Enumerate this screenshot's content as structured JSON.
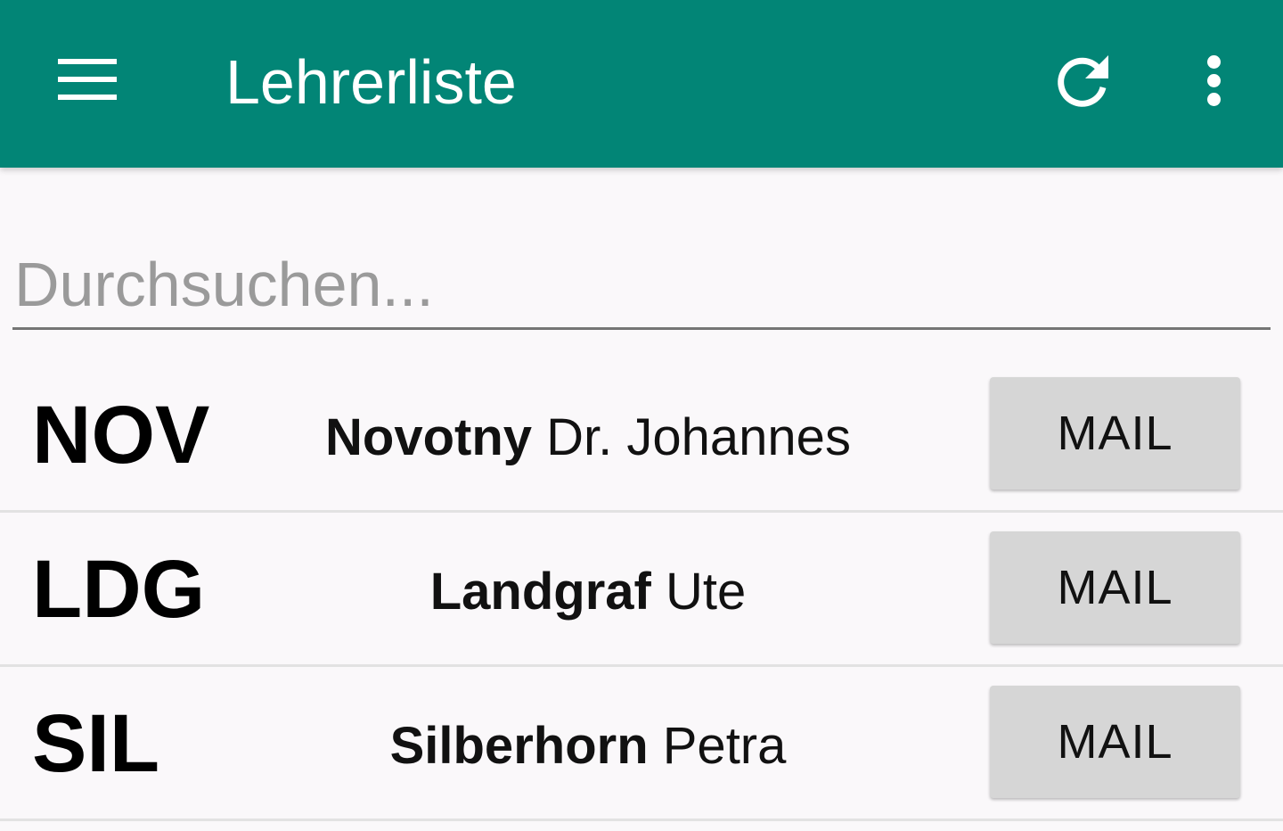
{
  "appbar": {
    "title": "Lehrerliste",
    "icons": [
      "menu-icon",
      "refresh-icon",
      "more-vertical-icon"
    ],
    "color": "#028576"
  },
  "search": {
    "placeholder": "Durchsuchen...",
    "value": ""
  },
  "teachers": [
    {
      "abbr": "NOV",
      "last_name": "Novotny",
      "first_name": "Dr. Johannes",
      "button": "MAIL"
    },
    {
      "abbr": "LDG",
      "last_name": "Landgraf",
      "first_name": "Ute",
      "button": "MAIL"
    },
    {
      "abbr": "SIL",
      "last_name": "Silberhorn",
      "first_name": "Petra",
      "button": "MAIL"
    }
  ]
}
